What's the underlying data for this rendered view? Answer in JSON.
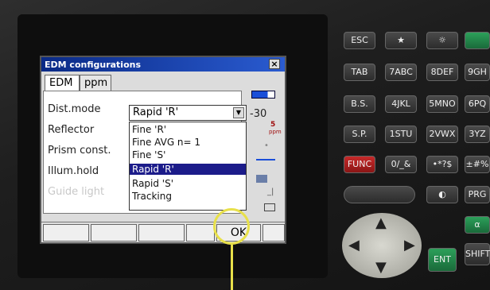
{
  "window": {
    "title": "EDM configurations",
    "close": "×"
  },
  "tabs": [
    {
      "label": "EDM"
    },
    {
      "label": "ppm"
    }
  ],
  "fields": {
    "dist_mode_label": "Dist.mode",
    "reflector_label": "Reflector",
    "prism_const_label": "Prism const.",
    "illum_hold_label": "Illum.hold",
    "hidden_label": "Guide light"
  },
  "select": {
    "value": "Rapid 'R'"
  },
  "dropdown": {
    "options": [
      "Fine 'R'",
      "Fine AVG n= 1",
      "Fine 'S'",
      "Rapid 'R'",
      "Rapid 'S'",
      "Tracking"
    ],
    "selected_index": 3
  },
  "sidebar": {
    "reading": "-30",
    "ppm_value": "5",
    "ppm_unit": "ppm"
  },
  "softkeys": [
    "",
    "",
    "",
    "",
    "OK",
    ""
  ],
  "keypad": {
    "esc": "ESC",
    "star": "★",
    "light": "☼",
    "tab": "TAB",
    "k7": "7ABC",
    "k8": "8DEF",
    "k9": "9GH",
    "bs": "B.S.",
    "k4": "4JKL",
    "k5": "5MNO",
    "k6": "6PQ",
    "sp": "S.P.",
    "k1": "1STU",
    "k2": "2VWX",
    "k3": "3YZ",
    "func": "FUNC",
    "k0": "0/_&",
    "kdot": "•*?$",
    "kpm": "±#%",
    "prg": "PRG",
    "alpha": "α",
    "ent": "ENT",
    "shift": "SHIFT"
  }
}
